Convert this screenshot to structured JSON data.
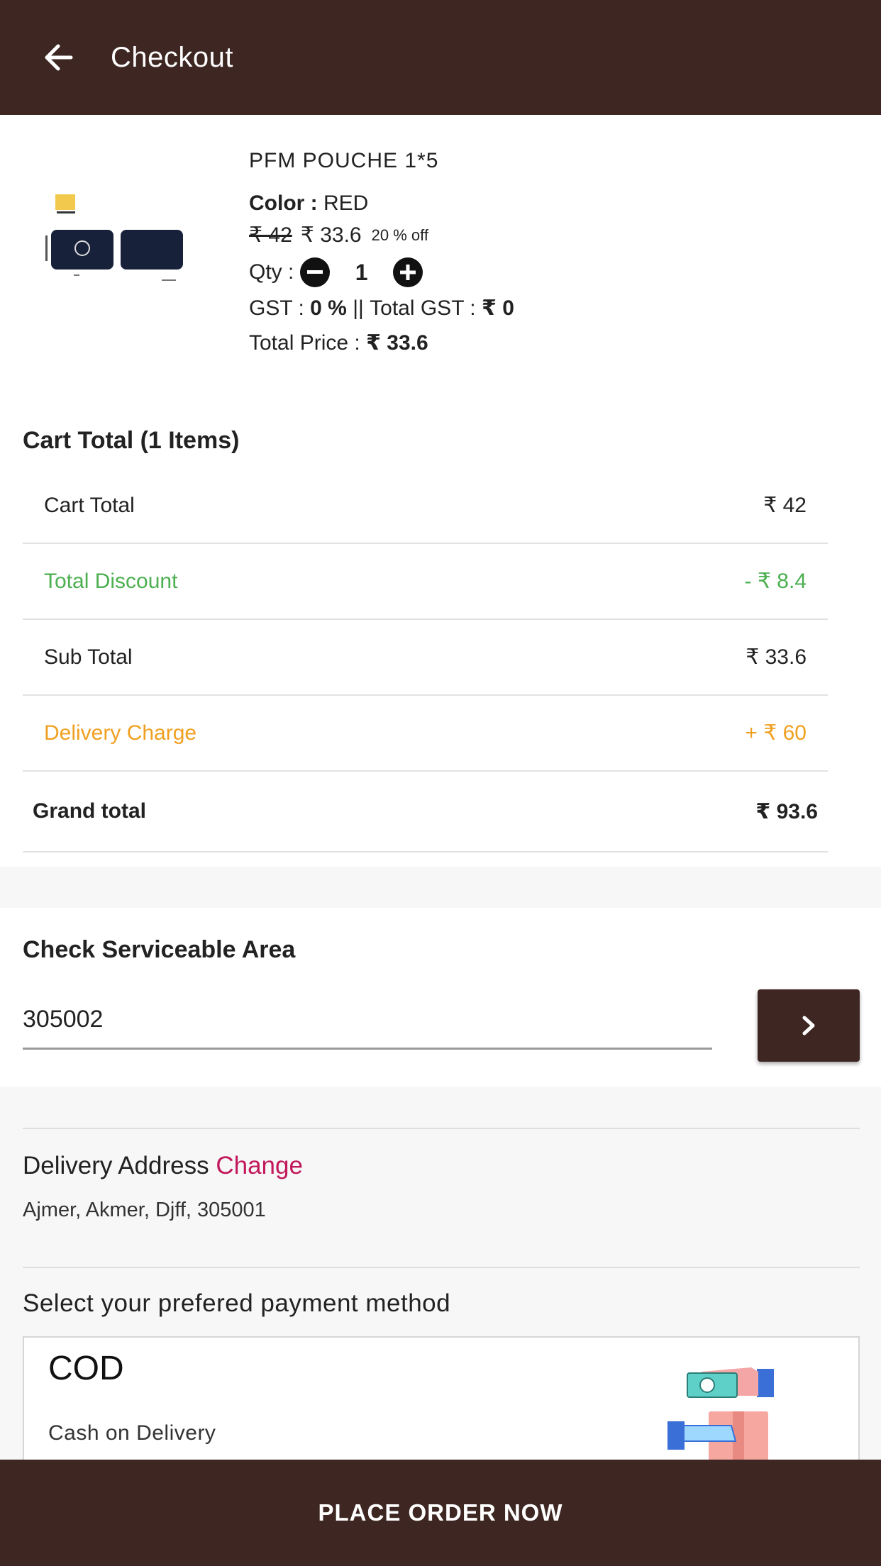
{
  "appbar": {
    "title": "Checkout"
  },
  "product": {
    "name": "PFM POUCHE 1*5",
    "color_label": "Color :",
    "color_value": "RED",
    "mrp": "₹ 42",
    "price": "₹ 33.6",
    "discount": "20 % off",
    "qty_label": "Qty :",
    "qty_value": "1",
    "gst_label": "GST :",
    "gst_value": "0 %",
    "gst_sep": "||",
    "total_gst_label": "Total GST :",
    "total_gst_value": "₹ 0",
    "total_price_label": "Total Price :",
    "total_price_value": "₹ 33.6"
  },
  "cart": {
    "heading": "Cart Total (1 Items)",
    "rows": [
      {
        "label": "Cart Total",
        "value": "₹ 42"
      },
      {
        "label": "Total Discount",
        "value": "- ₹ 8.4"
      },
      {
        "label": "Sub Total",
        "value": "₹ 33.6"
      },
      {
        "label": "Delivery Charge",
        "value": "+ ₹ 60"
      },
      {
        "label": "Grand total",
        "value": "₹ 93.6"
      }
    ]
  },
  "service": {
    "heading": "Check Serviceable Area",
    "pincode": "305002",
    "submit_icon": "chevron-right-icon"
  },
  "address": {
    "heading": "Delivery Address",
    "change_label": "Change",
    "text": "Ajmer, Akmer, Djff, 305001"
  },
  "payment": {
    "heading": "Select your prefered payment method",
    "method_title": "COD",
    "method_desc": "Cash on Delivery",
    "illustration": "cash-delivery-icon"
  },
  "footer": {
    "place_order": "PLACE ORDER NOW"
  },
  "colors": {
    "primary": "#3e2723",
    "discount": "#4caf50",
    "delivery": "#f0a020",
    "link": "#c2185b"
  }
}
